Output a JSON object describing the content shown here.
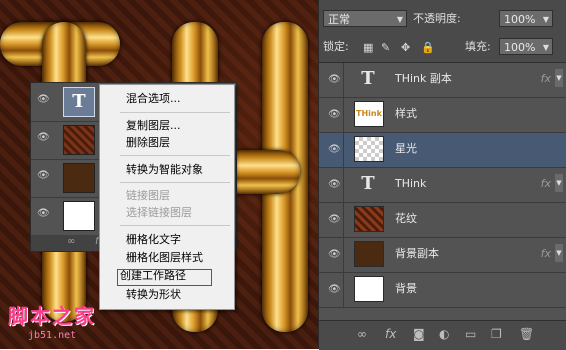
{
  "canvas": {
    "watermark_text": "脚本之家",
    "watermark_url": "jb51.net"
  },
  "mini_panel": {
    "rows": [
      {
        "type": "text",
        "glyph": "T"
      },
      {
        "type": "pattern"
      },
      {
        "type": "brown"
      },
      {
        "type": "white"
      }
    ],
    "bottom_icons": [
      "link-icon",
      "fx-icon"
    ]
  },
  "context_menu": {
    "items": [
      {
        "label": "混合选项...",
        "disabled": false
      },
      {
        "label": "复制图层...",
        "disabled": false
      },
      {
        "label": "删除图层",
        "disabled": false
      },
      {
        "label": "转换为智能对象",
        "disabled": false
      },
      {
        "label": "链接图层",
        "disabled": true
      },
      {
        "label": "选择链接图层",
        "disabled": true
      },
      {
        "label": "栅格化文字",
        "disabled": false
      },
      {
        "label": "栅格化图层样式",
        "disabled": false
      },
      {
        "label": "创建工作路径",
        "disabled": false,
        "highlighted": true
      },
      {
        "label": "转换为形状",
        "disabled": false
      }
    ]
  },
  "layers_panel": {
    "blend_mode": "正常",
    "opacity_label": "不透明度:",
    "opacity_value": "100%",
    "lock_label": "锁定:",
    "fill_label": "填充:",
    "fill_value": "100%",
    "layers": [
      {
        "name": "THink 副本",
        "thumb": "text",
        "fx": "fx",
        "selected": false
      },
      {
        "name": "样式",
        "thumb": "style",
        "fx": "",
        "selected": false
      },
      {
        "name": "星光",
        "thumb": "transparent",
        "fx": "",
        "selected": true
      },
      {
        "name": "THink",
        "thumb": "text",
        "fx": "fx",
        "selected": false
      },
      {
        "name": "花纹",
        "thumb": "pattern",
        "fx": "",
        "selected": false
      },
      {
        "name": "背景副本",
        "thumb": "brown",
        "fx": "fx",
        "selected": false
      },
      {
        "name": "背景",
        "thumb": "white",
        "fx": "",
        "selected": false
      }
    ],
    "bottom_icons": [
      "link-icon",
      "fx-icon",
      "mask-icon",
      "adjustment-icon",
      "folder-icon",
      "new-layer-icon",
      "trash-icon"
    ]
  },
  "colors": {
    "panel_bg": "#535353",
    "selected_row": "#485a73",
    "highlight_border": "#e02020"
  }
}
